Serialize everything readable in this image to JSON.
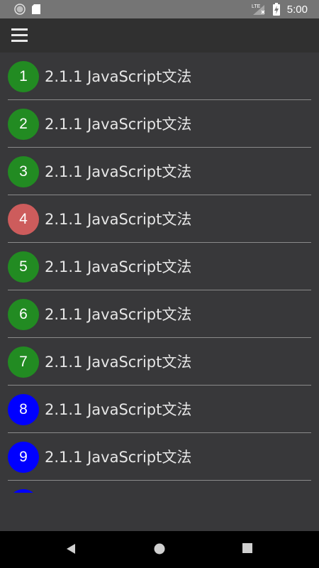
{
  "status_bar": {
    "time": "5:00",
    "network": "LTE",
    "left_icons": [
      "circle-icon",
      "sd-card-icon"
    ]
  },
  "toolbar": {
    "menu_icon": "hamburger-menu-icon"
  },
  "list": {
    "items": [
      {
        "number": "1",
        "label": "2.1.1 JavaScript文法",
        "color": "#228b22"
      },
      {
        "number": "2",
        "label": "2.1.1 JavaScript文法",
        "color": "#228b22"
      },
      {
        "number": "3",
        "label": "2.1.1 JavaScript文法",
        "color": "#228b22"
      },
      {
        "number": "4",
        "label": "2.1.1 JavaScript文法",
        "color": "#cd5c5c"
      },
      {
        "number": "5",
        "label": "2.1.1 JavaScript文法",
        "color": "#228b22"
      },
      {
        "number": "6",
        "label": "2.1.1 JavaScript文法",
        "color": "#228b22"
      },
      {
        "number": "7",
        "label": "2.1.1 JavaScript文法",
        "color": "#228b22"
      },
      {
        "number": "8",
        "label": "2.1.1 JavaScript文法",
        "color": "#0000ff"
      },
      {
        "number": "9",
        "label": "2.1.1 JavaScript文法",
        "color": "#0000ff"
      },
      {
        "number": "",
        "label": "",
        "color": "#0000ff"
      }
    ]
  },
  "nav_bar": {
    "back_icon": "back-triangle-icon",
    "home_icon": "home-circle-icon",
    "recents_icon": "recents-square-icon"
  },
  "colors": {
    "background": "#38383a",
    "status_bar": "#757575",
    "green": "#228b22",
    "red": "#cd5c5c",
    "blue": "#0000ff"
  }
}
